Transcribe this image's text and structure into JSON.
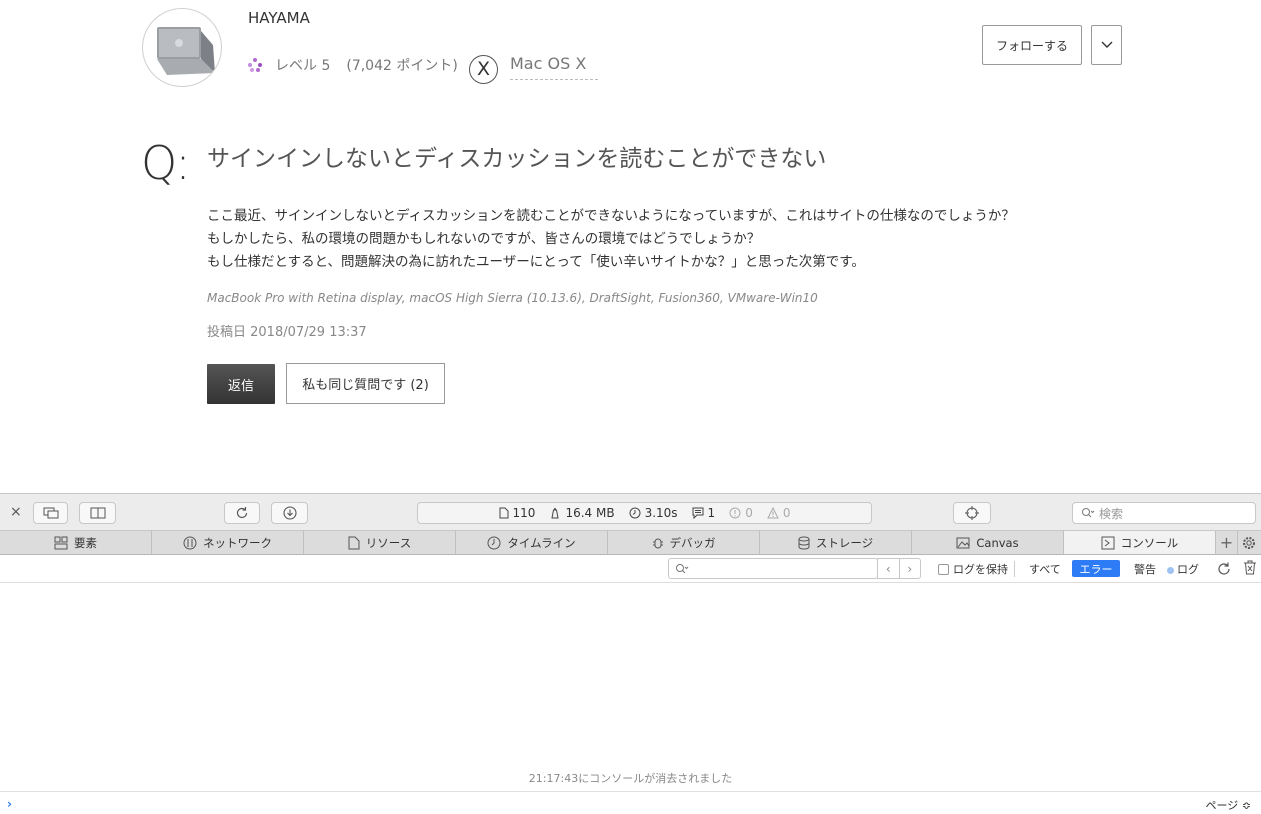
{
  "profile": {
    "username": "HAYAMA",
    "level": "レベル 5",
    "points": "(7,042 ポイント)",
    "os_badge": "X",
    "os_name": "Mac OS X",
    "follow_label": "フォローする"
  },
  "question": {
    "q_mark": "Q:",
    "title": "サインインしないとディスカッションを読むことができない",
    "body": [
      "ここ最近、サインインしないとディスカッションを読むことができないようになっていますが、これはサイトの仕様なのでしょうか？",
      "もしかしたら、私の環境の問題かもしれないのですが、皆さんの環境ではどうでしょうか？",
      "もし仕様だとすると、問題解決の為に訪れたユーザーにとって「使い辛いサイトかな？」と思った次第です。"
    ],
    "specs": "MacBook Pro with Retina display, macOS High Sierra (10.13.6), DraftSight, Fusion360, VMware-Win10",
    "posted": "投稿日 2018/07/29 13:37",
    "reply_label": "返信",
    "same_question_label": "私も同じ質問です (2)"
  },
  "inspector": {
    "close_glyph": "×",
    "stats": {
      "resources": "110",
      "size": "16.4 MB",
      "time": "3.10s",
      "logs": "1",
      "errors": "0",
      "warnings": "0"
    },
    "search_placeholder": "検索",
    "tabs": [
      {
        "label": "要素",
        "icon": "elements-icon"
      },
      {
        "label": "ネットワーク",
        "icon": "network-icon"
      },
      {
        "label": "リソース",
        "icon": "resources-icon"
      },
      {
        "label": "タイムライン",
        "icon": "timeline-icon"
      },
      {
        "label": "デバッガ",
        "icon": "debugger-icon"
      },
      {
        "label": "ストレージ",
        "icon": "storage-icon"
      },
      {
        "label": "Canvas",
        "icon": "canvas-icon"
      },
      {
        "label": "コンソール",
        "icon": "console-icon"
      }
    ],
    "filters": {
      "preserve_log": "ログを保持",
      "all": "すべて",
      "errors": "エラー",
      "warnings": "警告",
      "logs": "ログ"
    },
    "cleared_message": "21:17:43にコンソールが消去されました",
    "page_context": "ページ ≎",
    "accent_color": "#2d7cf6"
  }
}
